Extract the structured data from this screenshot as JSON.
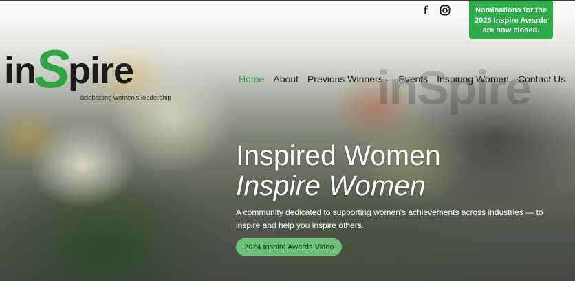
{
  "topbar": {
    "social": [
      {
        "name": "facebook-icon",
        "glyph": "f"
      },
      {
        "name": "instagram-icon"
      }
    ],
    "notice_line1": "Nominations for the",
    "notice_line2": "2025 Inspire Awards",
    "notice_line3": "are now closed.",
    "notice_color": "#2eac4a"
  },
  "logo": {
    "part1": "in",
    "part2": "S",
    "part3": "pire",
    "tagline": "celebrating women's leadership",
    "accent": "#2ea442"
  },
  "nav": {
    "items": [
      {
        "label": "Home",
        "active": true
      },
      {
        "label": "About"
      },
      {
        "label": "Previous Winners",
        "dropdown": true
      },
      {
        "label": "Events"
      },
      {
        "label": "Inspiring Women"
      },
      {
        "label": "Contact Us"
      }
    ]
  },
  "hero": {
    "title_line1": "Inspired Women",
    "title_line2": "Inspire Women",
    "subtitle_line1": "A community dedicated to supporting women's achievements across industries — to",
    "subtitle_line2": "inspire and help you inspire others.",
    "cta_label": "2024 Inspire Awards Video",
    "cta_color": "#6dc27a"
  }
}
